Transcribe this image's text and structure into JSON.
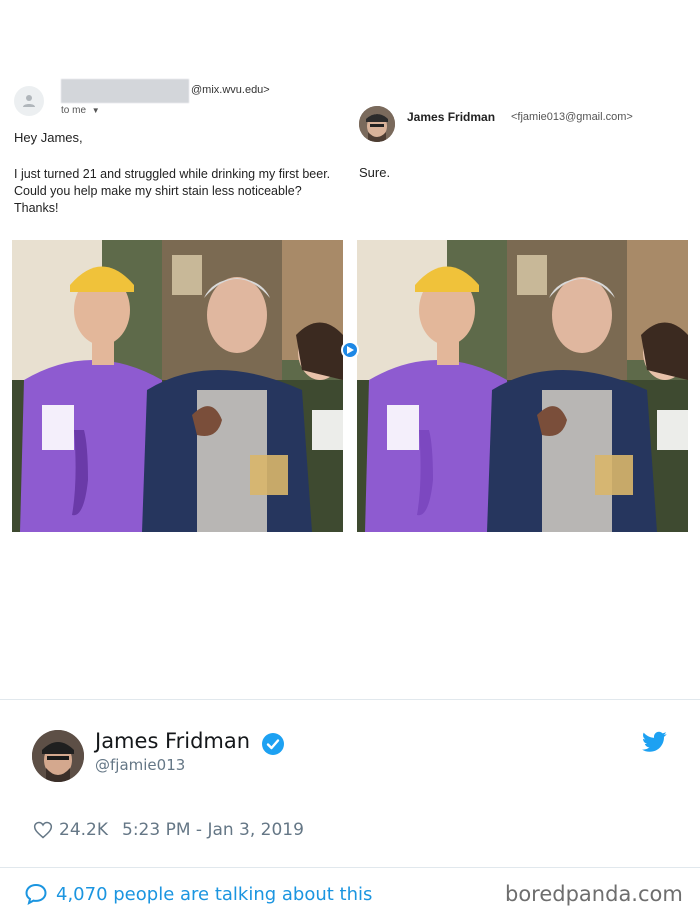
{
  "email": {
    "sender_domain": "@mix.wvu.edu>",
    "to_label": "to me",
    "greeting": "Hey James,",
    "body": "I just turned 21 and struggled while drinking my first beer. Could you help make my shirt stain less noticeable? Thanks!"
  },
  "reply": {
    "name": "James Fridman",
    "email": "<fjamie013@gmail.com>",
    "body": "Sure."
  },
  "tweet": {
    "name": "James Fridman",
    "handle": "@fjamie013",
    "likes": "24.2K",
    "timestamp": "5:23 PM - Jan 3, 2019",
    "talking": "4,070 people are talking about this"
  },
  "watermark": "boredpanda.com",
  "colors": {
    "twitter_blue": "#1da1f2",
    "link_blue": "#1b95e0",
    "meta_gray": "#657786",
    "shirt_purple": "#8e5bd0"
  },
  "icons": {
    "verified": "verified-badge-icon",
    "twitter": "twitter-bird-icon",
    "like": "heart-icon",
    "conversation": "speech-bubble-icon"
  }
}
